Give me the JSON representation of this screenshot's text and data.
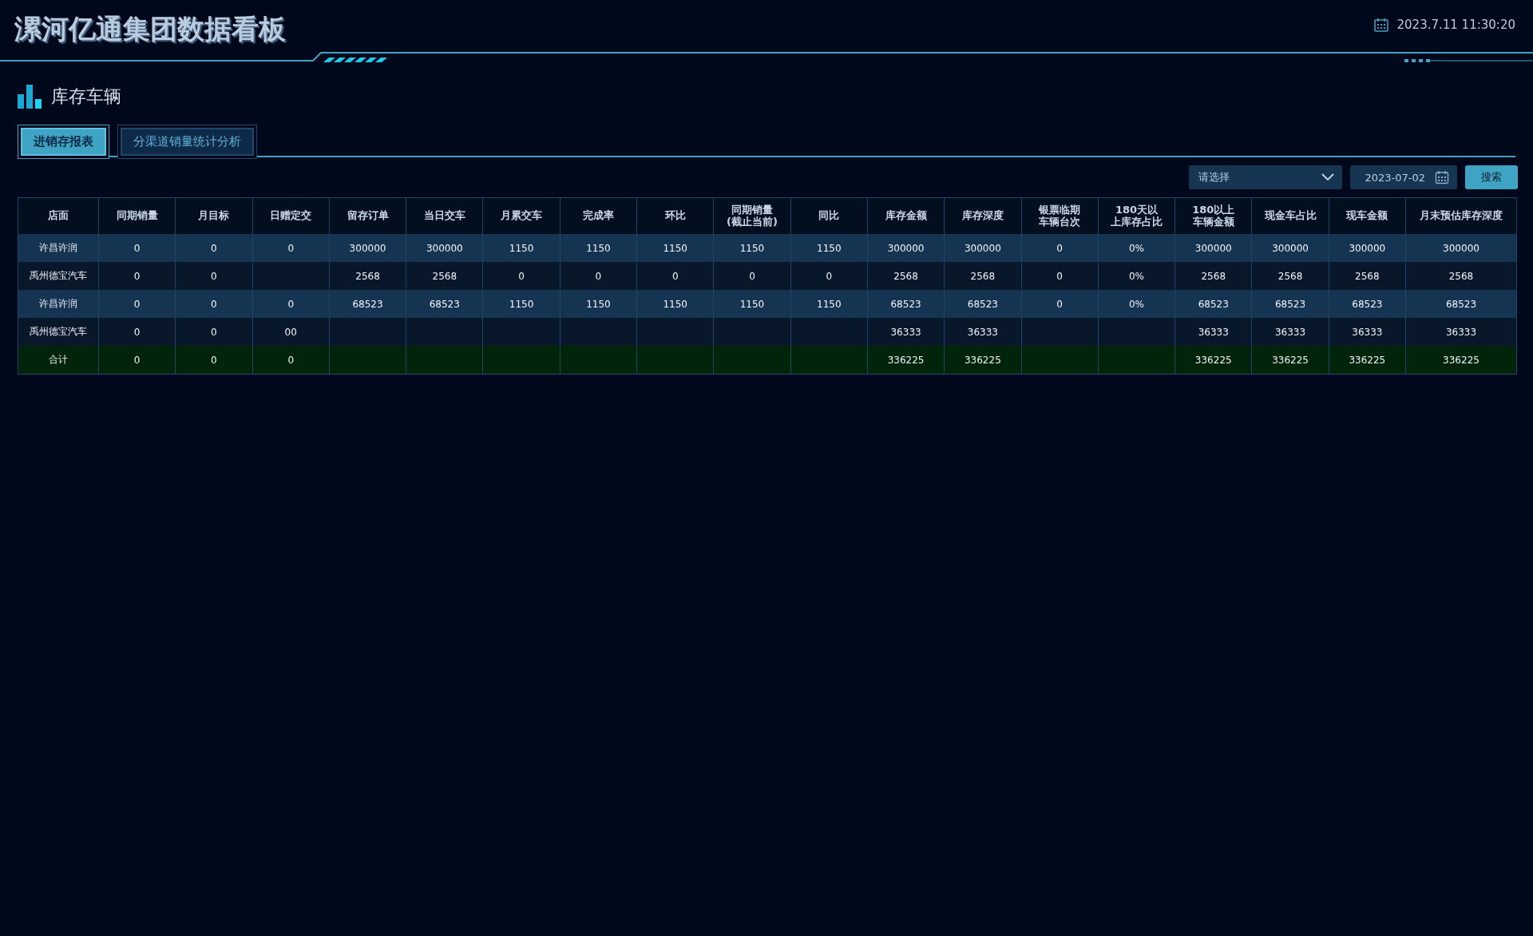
{
  "header": {
    "title": "漯河亿通集团数据看板",
    "datetime": "2023.7.11 11:30:20"
  },
  "section": {
    "title": "库存车辆"
  },
  "tabs": [
    {
      "label": "进销存报表",
      "selected": true
    },
    {
      "label": "分渠道销量统计分析",
      "selected": false
    }
  ],
  "filters": {
    "select": {
      "placeholder": "请选择"
    },
    "date": {
      "value": "2023-07-02"
    },
    "search_button": "搜索"
  },
  "table": {
    "columns": [
      "店面",
      "同期销量",
      "月目标",
      "日赠定交",
      "留存订单",
      "当日交车",
      "月累交车",
      "完成率",
      "环比",
      "同期销量(截止当前)",
      "同比",
      "库存金额",
      "库存深度",
      "银票临期车辆台次",
      "180天以上库存占比",
      "180以上车辆金额",
      "现金车占比",
      "现车金额",
      "月末预估库存深度"
    ],
    "rows": [
      {
        "kind": "data",
        "cells": [
          "许昌许润",
          "0",
          "0",
          "0",
          "300000",
          "300000",
          "1150",
          "1150",
          "1150",
          "1150",
          "1150",
          "300000",
          "300000",
          "0",
          "0%",
          "300000",
          "300000",
          "300000",
          "300000"
        ]
      },
      {
        "kind": "data",
        "cells": [
          "禹州德宝汽车",
          "0",
          "0",
          "",
          "2568",
          "2568",
          "0",
          "0",
          "0",
          "0",
          "0",
          "2568",
          "2568",
          "0",
          "0%",
          "2568",
          "2568",
          "2568",
          "2568"
        ]
      },
      {
        "kind": "data",
        "cells": [
          "许昌许润",
          "0",
          "0",
          "0",
          "68523",
          "68523",
          "1150",
          "1150",
          "1150",
          "1150",
          "1150",
          "68523",
          "68523",
          "0",
          "0%",
          "68523",
          "68523",
          "68523",
          "68523"
        ]
      },
      {
        "kind": "data",
        "cells": [
          "禹州德宝汽车",
          "0",
          "0",
          "00",
          "",
          "",
          "",
          "",
          "",
          "",
          "",
          "36333",
          "36333",
          "",
          "",
          "36333",
          "36333",
          "36333",
          "36333"
        ]
      },
      {
        "kind": "total",
        "cells": [
          "合计",
          "0",
          "0",
          "0",
          "",
          "",
          "",
          "",
          "",
          "",
          "",
          "336225",
          "336225",
          "",
          "",
          "336225",
          "336225",
          "336225",
          "336225"
        ]
      }
    ]
  }
}
